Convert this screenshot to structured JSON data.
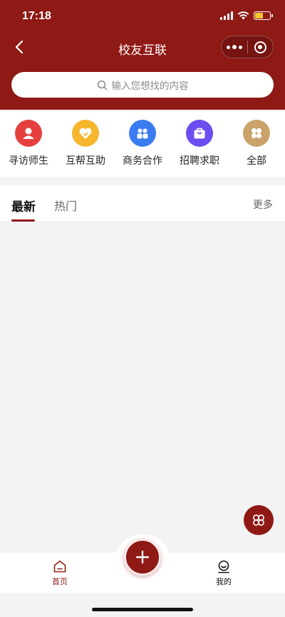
{
  "status_bar": {
    "time": "17:18"
  },
  "nav": {
    "title": "校友互联"
  },
  "search": {
    "placeholder": "输入您想找的内容"
  },
  "quick_actions": [
    {
      "label": "寻访师生",
      "icon": "person-icon",
      "color": "#e5403f"
    },
    {
      "label": "互帮互助",
      "icon": "heart-handshake-icon",
      "color": "#f6b72d"
    },
    {
      "label": "商务合作",
      "icon": "group-icon",
      "color": "#3b7bf0"
    },
    {
      "label": "招聘求职",
      "icon": "briefcase-icon",
      "color": "#6c4df0"
    },
    {
      "label": "全部",
      "icon": "grid-icon",
      "color": "#c9a36a"
    }
  ],
  "feed": {
    "tabs": [
      "最新",
      "热门"
    ],
    "active_tab": "最新",
    "more_label": "更多"
  },
  "tabbar": {
    "home_label": "首页",
    "mine_label": "我的"
  },
  "colors": {
    "brand": "#8f1915",
    "background": "#f3f3f4"
  }
}
